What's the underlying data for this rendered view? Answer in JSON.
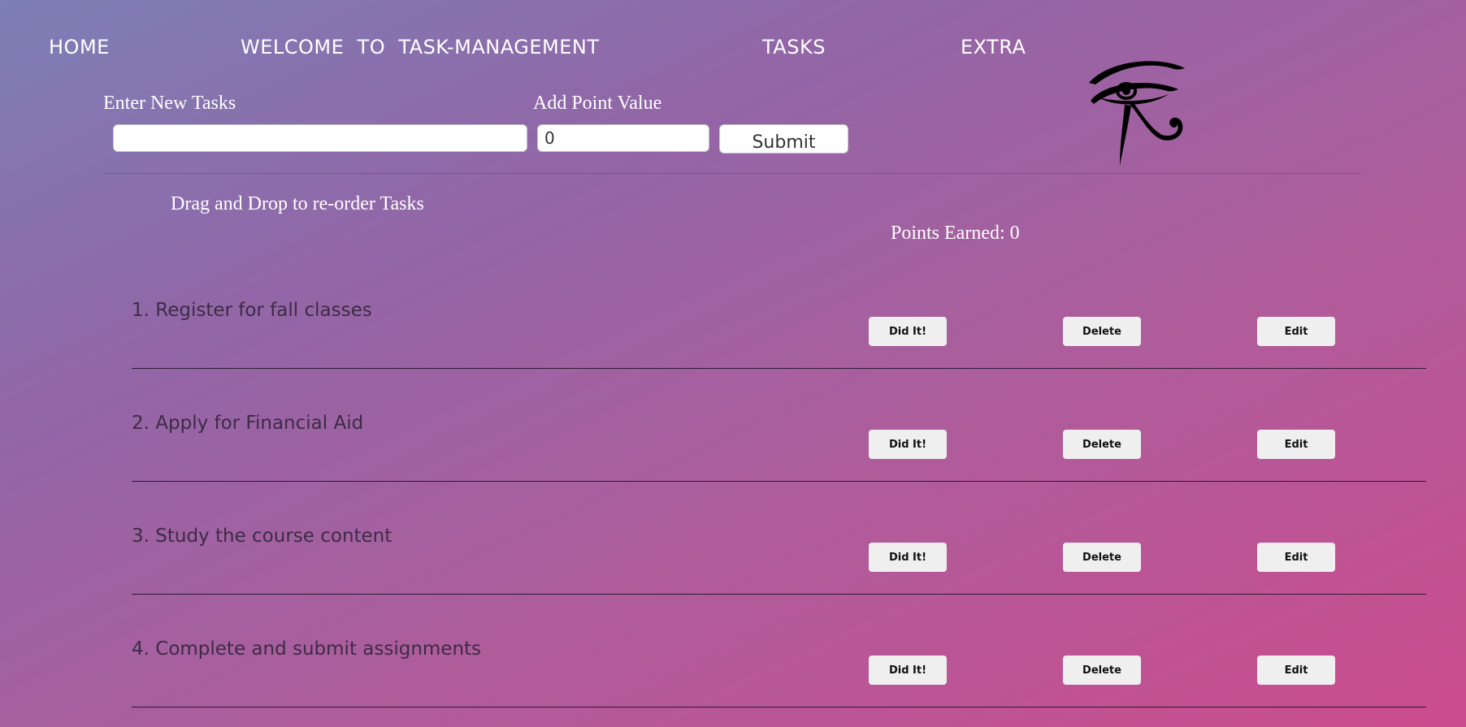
{
  "nav": {
    "home": "HOME",
    "welcome": "WELCOME  TO  TASK-MANAGEMENT",
    "tasks": "TASKS",
    "extra": "EXTRA"
  },
  "form": {
    "task_label": "Enter New Tasks",
    "task_value": "",
    "points_label": "Add Point Value",
    "points_value": "0",
    "submit_label": "Submit"
  },
  "logo_icon": "eye-of-ra-icon",
  "instructions": "Drag and Drop to re-order Tasks",
  "points_earned": "Points Earned: 0",
  "tasks": [
    {
      "text": "1. Register for fall classes",
      "did_label": "Did It!",
      "delete_label": "Delete",
      "edit_label": "Edit"
    },
    {
      "text": "2. Apply for Financial Aid",
      "did_label": "Did It!",
      "delete_label": "Delete",
      "edit_label": "Edit"
    },
    {
      "text": "3. Study the course content",
      "did_label": "Did It!",
      "delete_label": "Delete",
      "edit_label": "Edit"
    },
    {
      "text": "4. Complete and submit assignments",
      "did_label": "Did It!",
      "delete_label": "Delete",
      "edit_label": "Edit"
    }
  ],
  "colors": {
    "gradient_start": "#7d7fb6",
    "gradient_end": "#cb4c8e",
    "task_text": "#3d2b45",
    "button_bg": "#efefef"
  }
}
